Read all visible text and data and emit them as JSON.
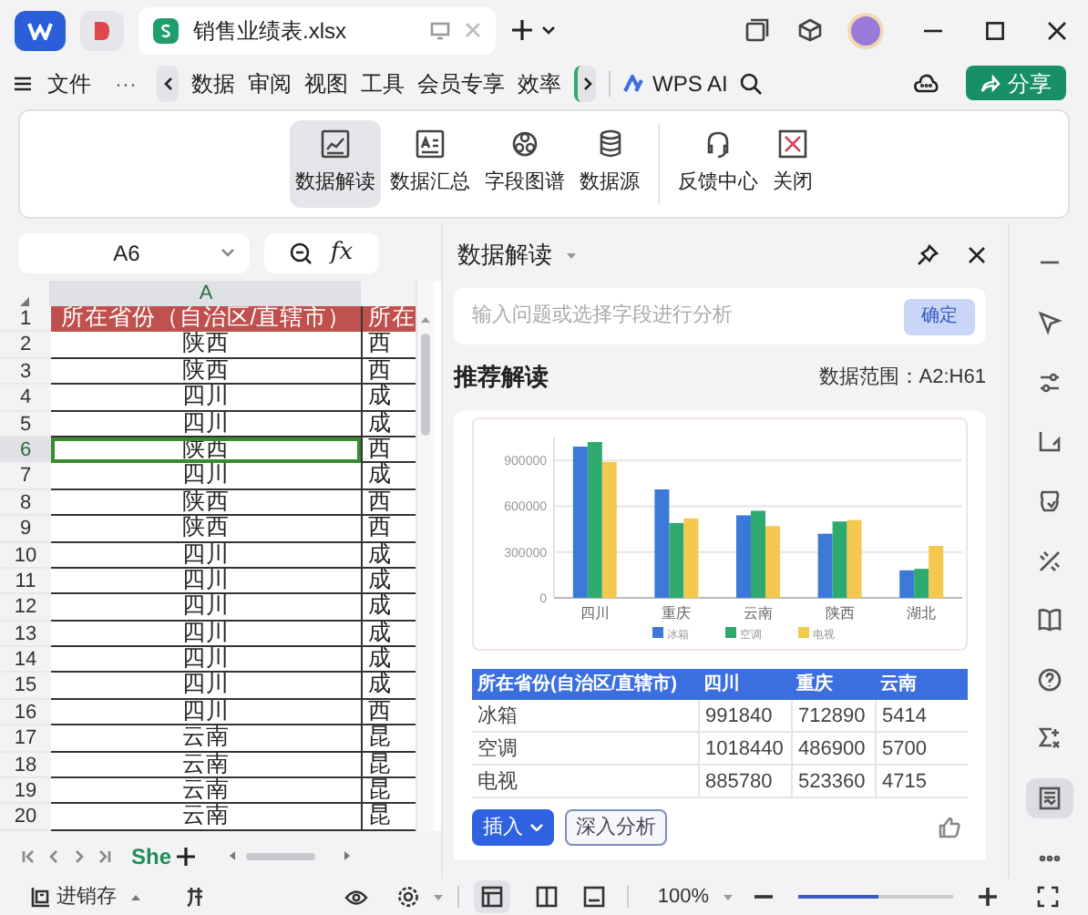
{
  "title_bar": {
    "document_tab": "销售业绩表.xlsx"
  },
  "menu": {
    "file": "文件",
    "more": "···",
    "items": [
      "数据",
      "审阅",
      "视图",
      "工具",
      "会员专享",
      "效率"
    ],
    "ai": "WPS AI",
    "share": "分享"
  },
  "ribbon": {
    "buttons": [
      {
        "label": "数据解读",
        "kind": "chart",
        "selected": true
      },
      {
        "label": "数据汇总",
        "kind": "summary",
        "selected": false
      },
      {
        "label": "字段图谱",
        "kind": "graph",
        "selected": false
      },
      {
        "label": "数据源",
        "kind": "database",
        "selected": false
      },
      {
        "label": "反馈中心",
        "kind": "headset",
        "selected": false
      },
      {
        "label": "关闭",
        "kind": "close",
        "selected": false
      }
    ]
  },
  "sheet": {
    "name_box": "A6",
    "fx": "fx",
    "column_header": "A",
    "sheet_tab": "She",
    "rows": [
      {
        "number": "1",
        "a": "所在省份（自治区/直辖市）",
        "b": "所在",
        "kind": "header",
        "selected": false
      },
      {
        "number": "2",
        "a": "陕西",
        "b": "西",
        "kind": "data",
        "selected": false
      },
      {
        "number": "3",
        "a": "陕西",
        "b": "西",
        "kind": "data",
        "selected": false
      },
      {
        "number": "4",
        "a": "四川",
        "b": "成",
        "kind": "data",
        "selected": false
      },
      {
        "number": "5",
        "a": "四川",
        "b": "成",
        "kind": "data",
        "selected": false
      },
      {
        "number": "6",
        "a": "陕西",
        "b": "西",
        "kind": "data",
        "selected": true
      },
      {
        "number": "7",
        "a": "四川",
        "b": "成",
        "kind": "data",
        "selected": false
      },
      {
        "number": "8",
        "a": "陕西",
        "b": "西",
        "kind": "data",
        "selected": false
      },
      {
        "number": "9",
        "a": "陕西",
        "b": "西",
        "kind": "data",
        "selected": false
      },
      {
        "number": "10",
        "a": "四川",
        "b": "成",
        "kind": "data",
        "selected": false
      },
      {
        "number": "11",
        "a": "四川",
        "b": "成",
        "kind": "data",
        "selected": false
      },
      {
        "number": "12",
        "a": "四川",
        "b": "成",
        "kind": "data",
        "selected": false
      },
      {
        "number": "13",
        "a": "四川",
        "b": "成",
        "kind": "data",
        "selected": false
      },
      {
        "number": "14",
        "a": "四川",
        "b": "成",
        "kind": "data",
        "selected": false
      },
      {
        "number": "15",
        "a": "四川",
        "b": "成",
        "kind": "data",
        "selected": false
      },
      {
        "number": "16",
        "a": "四川",
        "b": "西",
        "kind": "data",
        "selected": false
      },
      {
        "number": "17",
        "a": "云南",
        "b": "昆",
        "kind": "data",
        "selected": false
      },
      {
        "number": "18",
        "a": "云南",
        "b": "昆",
        "kind": "data",
        "selected": false
      },
      {
        "number": "19",
        "a": "云南",
        "b": "昆",
        "kind": "data",
        "selected": false
      },
      {
        "number": "20",
        "a": "云南",
        "b": "昆",
        "kind": "data",
        "selected": false
      }
    ]
  },
  "panel": {
    "title": "数据解读",
    "placeholder": "输入问题或选择字段进行分析",
    "confirm": "确定",
    "section": "推荐解读",
    "range": "数据范围：A2:H61",
    "chart_data": {
      "type": "bar",
      "categories": [
        "四川",
        "重庆",
        "云南",
        "陕西",
        "湖北"
      ],
      "yticks": [
        {
          "value": 0,
          "label": "0"
        },
        {
          "value": 300000,
          "label": "300000"
        },
        {
          "value": 600000,
          "label": "600000"
        },
        {
          "value": 900000,
          "label": "900000"
        }
      ],
      "ylim": [
        0,
        1050000
      ],
      "grid": true,
      "legend": true,
      "series": [
        {
          "name": "冰箱",
          "color": "#3b78d8",
          "values": [
            990000,
            710000,
            540000,
            420000,
            180000
          ]
        },
        {
          "name": "空调",
          "color": "#2eaa6e",
          "values": [
            1020000,
            490000,
            570000,
            500000,
            190000
          ]
        },
        {
          "name": "电视",
          "color": "#f5c94f",
          "values": [
            890000,
            520000,
            470000,
            510000,
            340000
          ]
        }
      ]
    },
    "table": {
      "columns": [
        "所在省份(自治区/直辖市)",
        "四川",
        "重庆",
        "云南"
      ],
      "rows": [
        [
          "冰箱",
          "991840",
          "712890",
          "5414"
        ],
        [
          "空调",
          "1018440",
          "486900",
          "5700"
        ],
        [
          "电视",
          "885780",
          "523360",
          "4715"
        ]
      ]
    },
    "insert": "插入",
    "analyze": "深入分析"
  },
  "right_toolbar": [
    {
      "kind": "minus",
      "selected": false
    },
    {
      "kind": "cursor",
      "selected": false
    },
    {
      "kind": "sliders",
      "selected": false
    },
    {
      "kind": "crop",
      "selected": false
    },
    {
      "kind": "shape",
      "selected": false
    },
    {
      "kind": "tools",
      "selected": false
    },
    {
      "kind": "book",
      "selected": false
    },
    {
      "kind": "help",
      "selected": false
    },
    {
      "kind": "sigma",
      "selected": false
    },
    {
      "kind": "doc",
      "selected": true
    },
    {
      "kind": "more",
      "selected": false
    }
  ],
  "status_bar": {
    "sheet_name": "进销存",
    "zoom": "100%",
    "zoom_slider": {
      "level": 0.52
    }
  }
}
